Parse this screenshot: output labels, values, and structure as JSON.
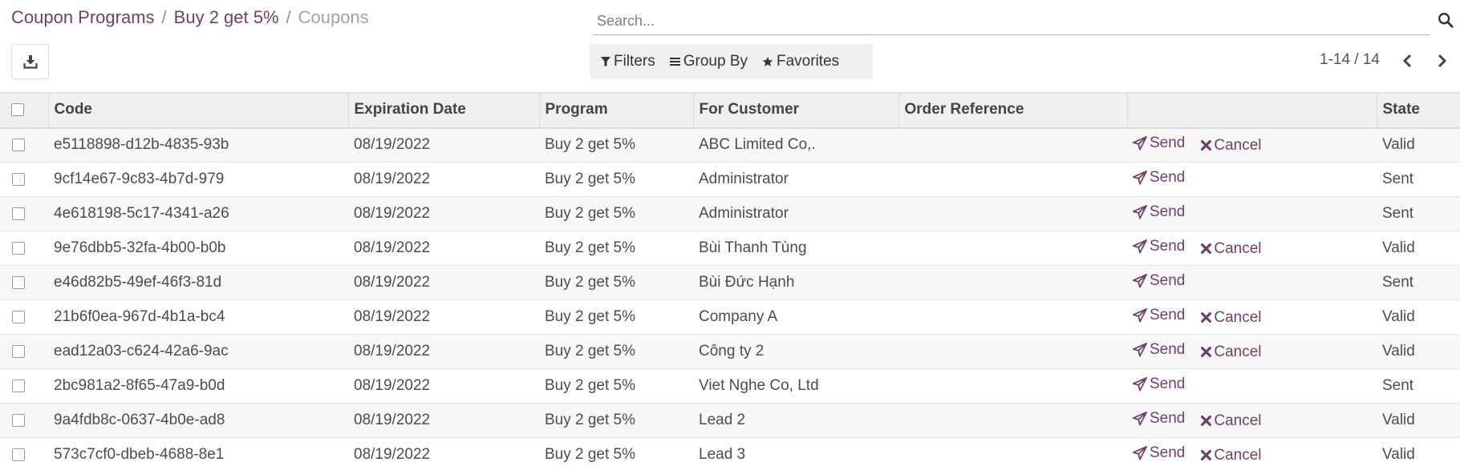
{
  "breadcrumb": {
    "items": [
      "Coupon Programs",
      "Buy 2 get 5%"
    ],
    "separator": "/",
    "current": "Coupons"
  },
  "search": {
    "placeholder": "Search...",
    "value": ""
  },
  "search_panel": {
    "filters": "Filters",
    "group_by": "Group By",
    "favorites": "Favorites"
  },
  "pager": {
    "value": "1-14 / 14"
  },
  "icons": {
    "download": "download-icon",
    "search": "search-icon",
    "filter": "filter-icon",
    "group_by": "list-icon",
    "favorites": "star-icon",
    "prev": "chevron-left-icon",
    "next": "chevron-right-icon",
    "send": "paper-plane-icon",
    "cancel": "times-icon"
  },
  "colors": {
    "accent": "#71406b",
    "search_underline": "#7ec4c3",
    "header_bg": "#efefef"
  },
  "table": {
    "columns": [
      "Code",
      "Expiration Date",
      "Program",
      "For Customer",
      "Order Reference",
      "",
      "State"
    ],
    "send_label": "Send",
    "cancel_label": "Cancel",
    "rows": [
      {
        "code": "e5118898-d12b-4835-93b",
        "expiration": "08/19/2022",
        "program": "Buy 2 get 5%",
        "customer": "ABC Limited Co,.",
        "order_ref": "",
        "can_cancel": true,
        "state": "Valid"
      },
      {
        "code": "9cf14e67-9c83-4b7d-979",
        "expiration": "08/19/2022",
        "program": "Buy 2 get 5%",
        "customer": "Administrator",
        "order_ref": "",
        "can_cancel": false,
        "state": "Sent"
      },
      {
        "code": "4e618198-5c17-4341-a26",
        "expiration": "08/19/2022",
        "program": "Buy 2 get 5%",
        "customer": "Administrator",
        "order_ref": "",
        "can_cancel": false,
        "state": "Sent"
      },
      {
        "code": "9e76dbb5-32fa-4b00-b0b",
        "expiration": "08/19/2022",
        "program": "Buy 2 get 5%",
        "customer": "Bùi Thanh Tùng",
        "order_ref": "",
        "can_cancel": true,
        "state": "Valid"
      },
      {
        "code": "e46d82b5-49ef-46f3-81d",
        "expiration": "08/19/2022",
        "program": "Buy 2 get 5%",
        "customer": "Bùi Đức Hạnh",
        "order_ref": "",
        "can_cancel": false,
        "state": "Sent"
      },
      {
        "code": "21b6f0ea-967d-4b1a-bc4",
        "expiration": "08/19/2022",
        "program": "Buy 2 get 5%",
        "customer": "Company A",
        "order_ref": "",
        "can_cancel": true,
        "state": "Valid"
      },
      {
        "code": "ead12a03-c624-42a6-9ac",
        "expiration": "08/19/2022",
        "program": "Buy 2 get 5%",
        "customer": "Công ty 2",
        "order_ref": "",
        "can_cancel": true,
        "state": "Valid"
      },
      {
        "code": "2bc981a2-8f65-47a9-b0d",
        "expiration": "08/19/2022",
        "program": "Buy 2 get 5%",
        "customer": "Viet Nghe Co, Ltd",
        "order_ref": "",
        "can_cancel": false,
        "state": "Sent"
      },
      {
        "code": "9a4fdb8c-0637-4b0e-ad8",
        "expiration": "08/19/2022",
        "program": "Buy 2 get 5%",
        "customer": "Lead 2",
        "order_ref": "",
        "can_cancel": true,
        "state": "Valid"
      },
      {
        "code": "573c7cf0-dbeb-4688-8e1",
        "expiration": "08/19/2022",
        "program": "Buy 2 get 5%",
        "customer": "Lead 3",
        "order_ref": "",
        "can_cancel": true,
        "state": "Valid"
      }
    ]
  }
}
